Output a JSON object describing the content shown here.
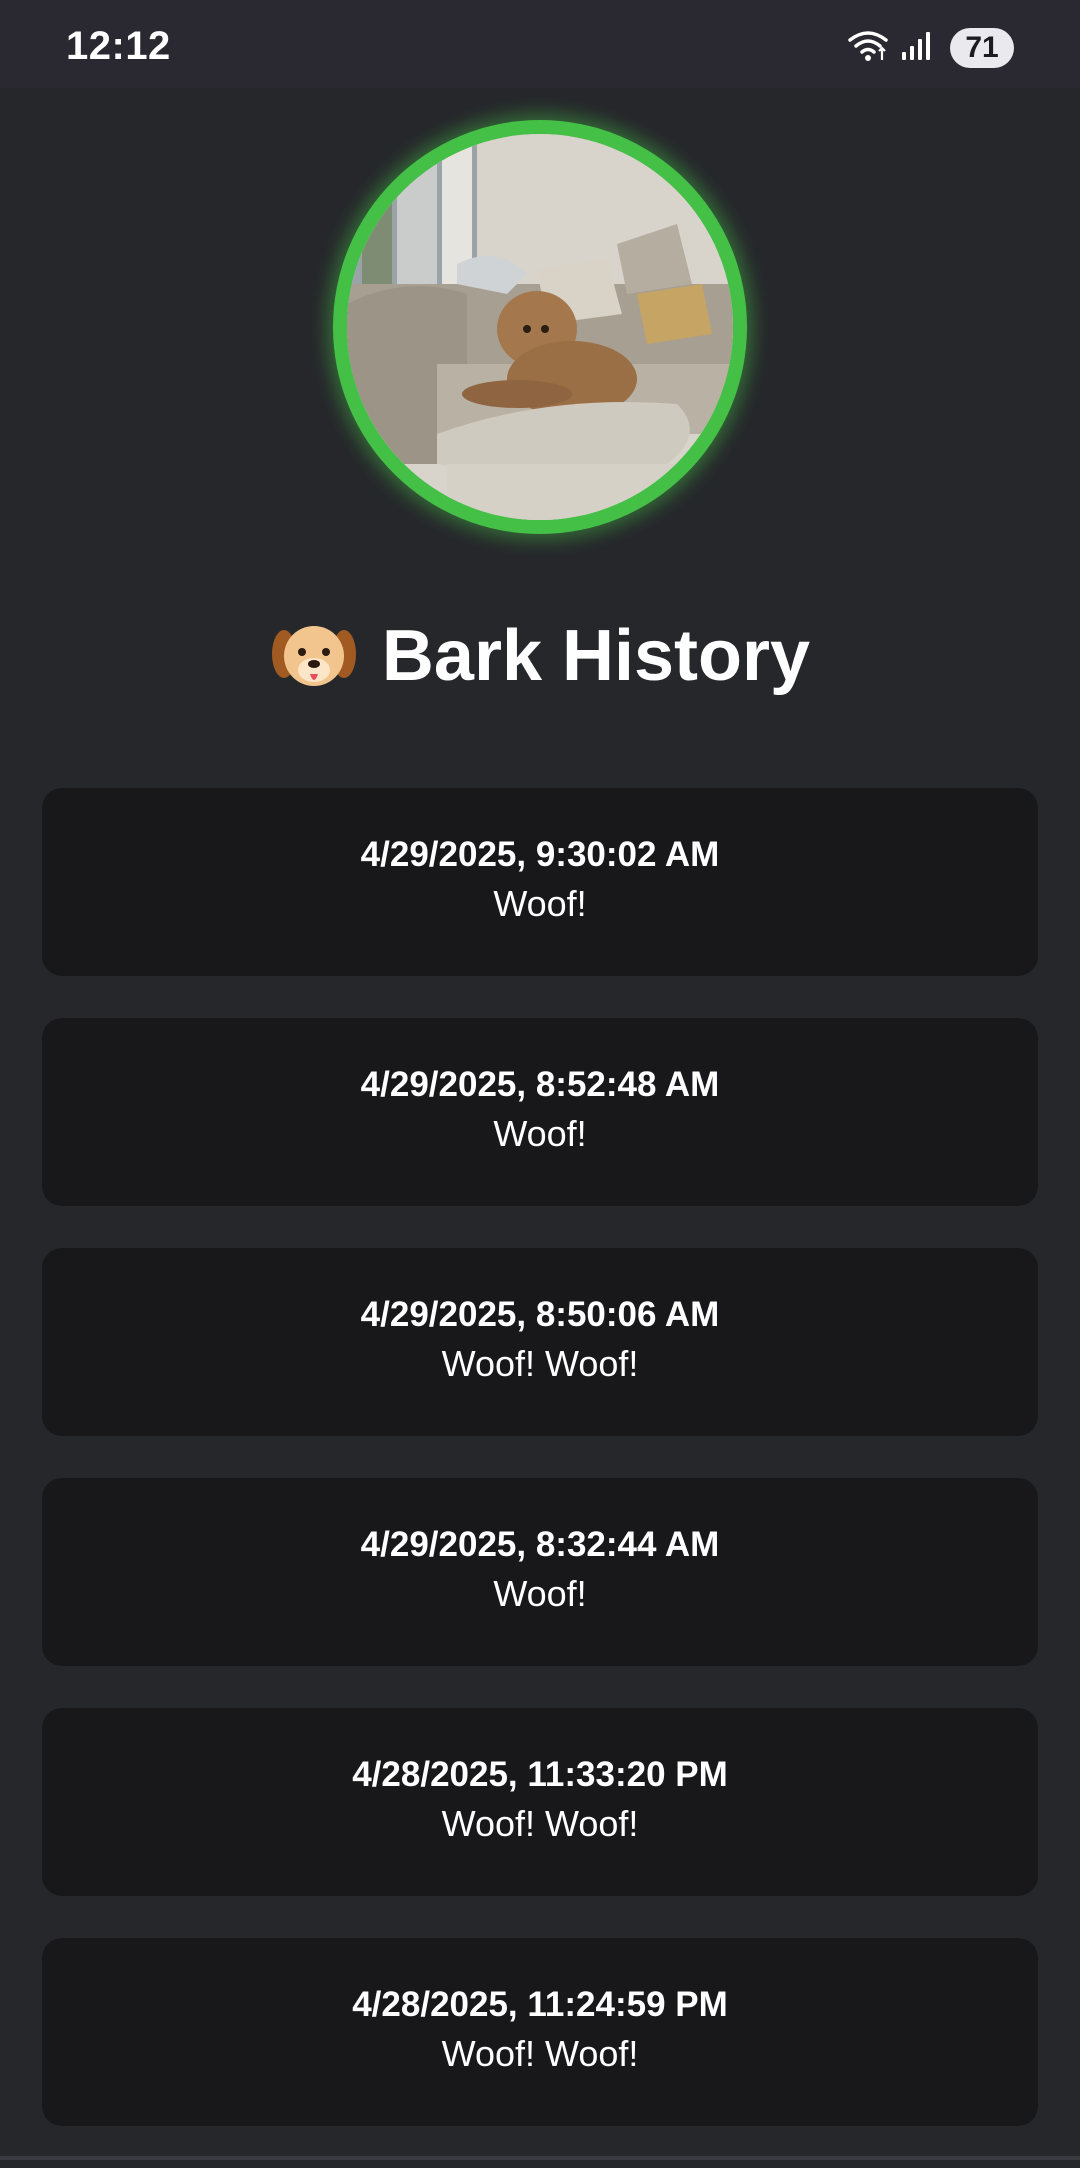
{
  "status_bar": {
    "time": "12:12",
    "battery": "71",
    "icons": [
      "wifi-icon",
      "signal-icon",
      "battery-icon"
    ]
  },
  "profile": {
    "image": "dog-on-sofa-photo",
    "ring_color": "#44c047"
  },
  "page": {
    "emoji": "dog-face-icon",
    "title": "Bark History"
  },
  "barks": [
    {
      "time": "4/29/2025, 9:30:02 AM",
      "message": "Woof!"
    },
    {
      "time": "4/29/2025, 8:52:48 AM",
      "message": "Woof!"
    },
    {
      "time": "4/29/2025, 8:50:06 AM",
      "message": "Woof! Woof!"
    },
    {
      "time": "4/29/2025, 8:32:44 AM",
      "message": "Woof!"
    },
    {
      "time": "4/28/2025, 11:33:20 PM",
      "message": "Woof! Woof!"
    },
    {
      "time": "4/28/2025, 11:24:59 PM",
      "message": "Woof! Woof!"
    }
  ],
  "colors": {
    "background": "#26272b",
    "card": "#18181b",
    "accent": "#44c047"
  }
}
